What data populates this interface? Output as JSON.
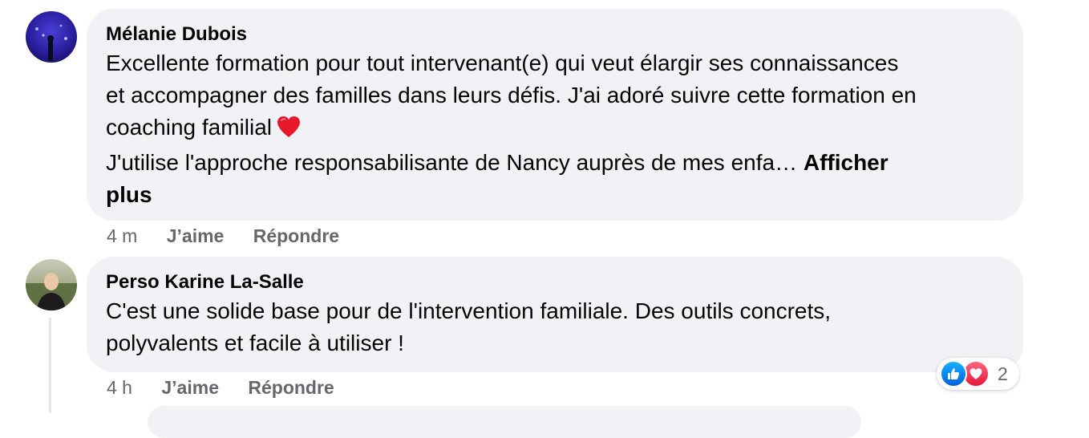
{
  "comments": [
    {
      "author": "Mélanie Dubois",
      "avatar_icon": "avatar-night-scene",
      "lines": [
        "Excellente formation pour tout intervenant(e) qui veut élargir ses connaissances",
        "et accompagner des familles dans leurs défis. J'ai adoré suivre cette formation en",
        "coaching familial",
        "J'utilise l'approche responsabilisante de Nancy auprès de mes enfa…",
        "plus"
      ],
      "emoji": "red-heart-icon",
      "see_more_first": "Afficher",
      "time": "4 m",
      "like_label": "J’aime",
      "reply_label": "Répondre"
    },
    {
      "author": "Perso Karine La-Salle",
      "avatar_icon": "avatar-woman-outdoor",
      "lines": [
        "C'est une solide base pour de l'intervention familiale. Des outils concrets,",
        "polyvalents et facile à utiliser !"
      ],
      "time": "4 h",
      "like_label": "J’aime",
      "reply_label": "Répondre",
      "reactions": {
        "icons": [
          "like-icon",
          "love-icon"
        ],
        "count": "2",
        "like_color": "#1877f2",
        "love_color": "#f33e58"
      }
    }
  ],
  "colors": {
    "bubble": "#f0f2f5",
    "meta_text": "#65676b",
    "text": "#050505"
  }
}
